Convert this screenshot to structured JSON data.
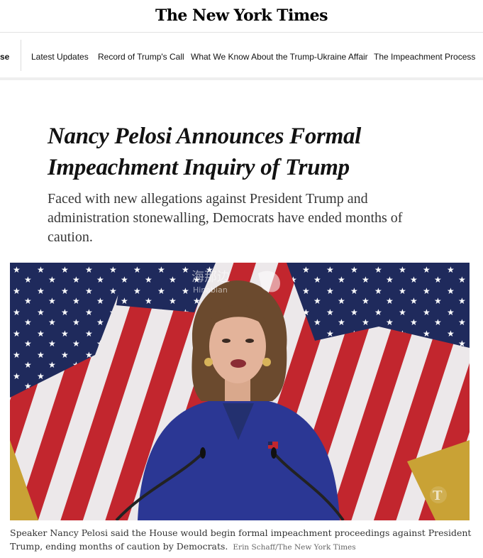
{
  "masthead": {
    "logo_text": "The New York Times"
  },
  "nav": {
    "partial_item": "se",
    "items": [
      {
        "label": "Latest Updates"
      },
      {
        "label": "Record of Trump's Call"
      },
      {
        "label": "What We Know About the Trump-Ukraine Affair"
      },
      {
        "label": "The Impeachment Process"
      }
    ]
  },
  "article": {
    "headline_line1": "Nancy Pelosi Announces Formal",
    "headline_line2": "Impeachment Inquiry of Trump",
    "summary": "Faced with new allegations against President Trump and administration stonewalling, Democrats have ended months of caution."
  },
  "photo": {
    "watermark_cn": "海那边",
    "watermark_en": "Hinabian",
    "caption": "Speaker Nancy Pelosi said the House would begin formal impeachment proceedings against President Trump, ending months of caution by Democrats.",
    "credit": "Erin Schaff/The New York Times"
  },
  "colors": {
    "flag_red": "#c2262e",
    "flag_blue": "#1f2a5c",
    "jacket": "#2b3794",
    "text": "#121212"
  }
}
